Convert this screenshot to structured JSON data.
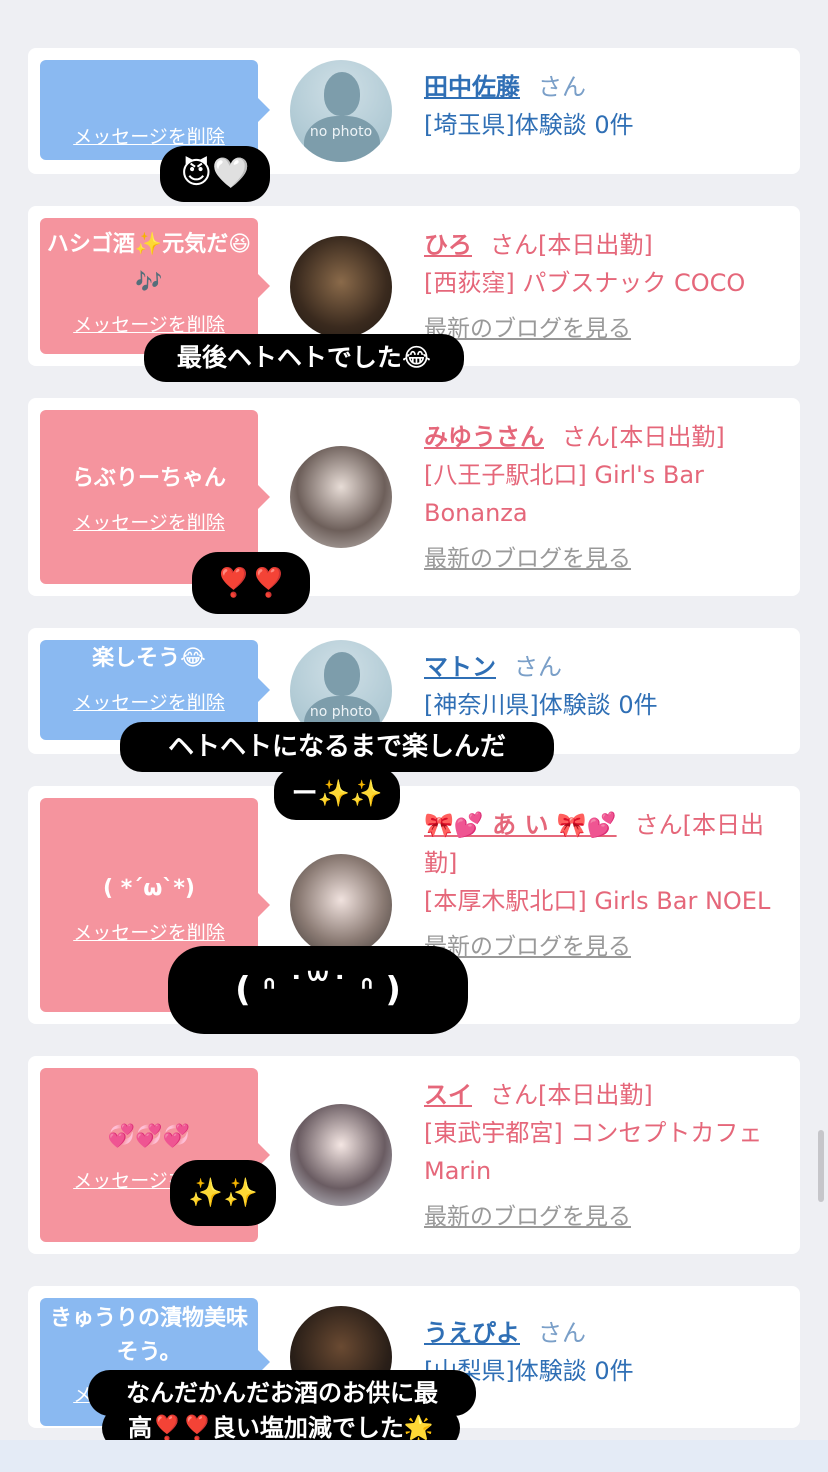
{
  "delete_label": "メッセージを削除",
  "blog_label": "最新のブログを見る",
  "cards": [
    {
      "name": "田中佐藤",
      "san": "さん",
      "line2": "[埼玉県]体験談 0件",
      "message": ""
    },
    {
      "name": "ひろ",
      "san": "さん[本日出勤]",
      "line2": "[西荻窪] パブスナック COCO",
      "message": "ハシゴ酒✨元気だ😆🎶"
    },
    {
      "name": "みゆうさん",
      "san": "さん[本日出勤]",
      "line2": "[八王子駅北口] Girl's Bar Bonanza",
      "message": "らぶりーちゃん"
    },
    {
      "name": "マトン",
      "san": "さん",
      "line2": "[神奈川県]体験談 0件",
      "message": "楽しそう😂"
    },
    {
      "name": "🎀💕 あ い 🎀💕",
      "san": "さん[本日出勤]",
      "line2": "[本厚木駅北口] Girls Bar NOEL",
      "message": "( *´ω`*)"
    },
    {
      "name": "スイ",
      "san": "さん[本日出勤]",
      "line2": "[東武宇都宮] コンセプトカフェMarin",
      "message": "💞💞💞"
    },
    {
      "name": "うえぴよ",
      "san": "さん",
      "line2": "[山梨県]体験談 0件",
      "message": "きゅうりの漬物美味そう。"
    }
  ],
  "no_photo": "no photo",
  "stickers": {
    "s1": "😈🤍",
    "s2": "最後ヘトヘトでした😂",
    "s3": "❣️❣️",
    "s4a": "ヘトヘトになるまで楽しんだ",
    "s4b": "ー✨✨",
    "s5": "( ᐢ ˙꒳​˙ ᐢ )",
    "s6": "✨✨",
    "s7a": "なんだかんだお酒のお供に最",
    "s7b": "高❣️❣️良い塩加減でした🌟"
  }
}
